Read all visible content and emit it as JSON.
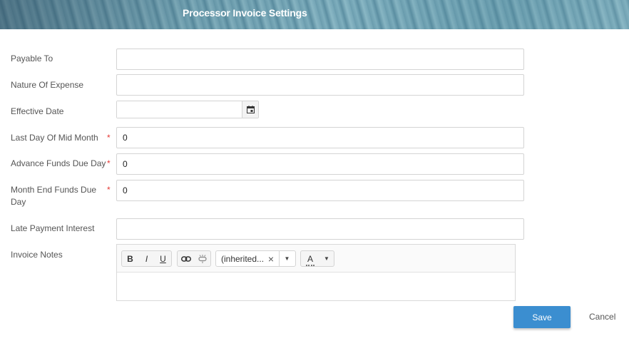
{
  "header": {
    "title": "Processor Invoice Settings"
  },
  "form": {
    "payable_to": {
      "label": "Payable To",
      "value": ""
    },
    "nature_of_expense": {
      "label": "Nature Of Expense",
      "value": ""
    },
    "effective_date": {
      "label": "Effective Date",
      "value": "",
      "icon": "calendar-icon"
    },
    "last_day_mid_month": {
      "label": "Last Day Of Mid Month",
      "value": "0",
      "required": "*"
    },
    "advance_funds_due_day": {
      "label": "Advance Funds Due Day",
      "value": "0",
      "required": "*"
    },
    "month_end_funds_due_day": {
      "label": "Month End Funds Due Day",
      "value": "0",
      "required": "*"
    },
    "late_payment_interest": {
      "label": "Late Payment Interest",
      "value": ""
    },
    "invoice_notes": {
      "label": "Invoice Notes",
      "value": ""
    }
  },
  "editor_toolbar": {
    "bold": "B",
    "italic": "I",
    "underline": "U",
    "font_value": "(inherited...",
    "font_clear": "×",
    "dropdown_arrow": "▼",
    "font_color": "A"
  },
  "actions": {
    "save": "Save",
    "cancel": "Cancel"
  },
  "colors": {
    "accent": "#3b8ed0",
    "required": "#e53935"
  }
}
